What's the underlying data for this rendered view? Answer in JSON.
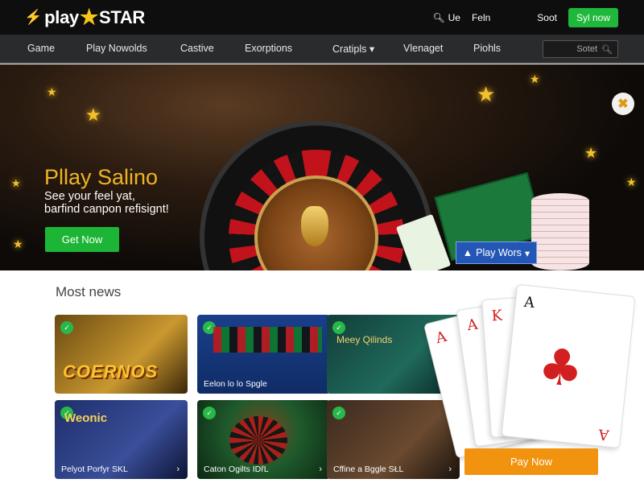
{
  "header": {
    "brand_left": "play",
    "brand_right": "STAR",
    "search_label": "Ue",
    "login_label": "Feln",
    "sort_label": "Soot",
    "signup_label": "Syl now"
  },
  "nav": {
    "items": [
      "Game",
      "Play Nowolds",
      "Castive",
      "Exorptions",
      "Cratipls",
      "Vlenaget",
      "Piohls"
    ],
    "search_placeholder": "Sotet"
  },
  "hero": {
    "title": "Pllay Salino",
    "subtitle": "See your feel yat, barfind canpon refisignt!",
    "cta_label": "Get Now",
    "dropdown_label": "Play Wors",
    "badge": "✖"
  },
  "main": {
    "section_title": "Most news",
    "tiles": [
      {
        "caption": "",
        "big_label": "COERNOS",
        "chev": "",
        "theme": "gold"
      },
      {
        "caption": "Eelon lo lo Spgle",
        "big_label": "",
        "chev": "",
        "theme": "blue"
      },
      {
        "caption": "",
        "big_label": "",
        "small_label": "Meey Qilinds",
        "chev": "",
        "theme": "teal"
      },
      {
        "caption": "Pelyot Porfyr SKL",
        "big_label": "",
        "small_label": "Weonic",
        "chev": "›",
        "theme": "navy"
      },
      {
        "caption": "Caton Ogilts IDřL",
        "big_label": "",
        "chev": "›",
        "theme": "green"
      },
      {
        "caption": "Cffine a Bggle SŁL",
        "big_label": "",
        "chev": "›",
        "theme": "dark"
      }
    ],
    "pay_now_label": "Pay Now",
    "cards": [
      "A",
      "A",
      "K",
      "A",
      "A"
    ]
  },
  "colors": {
    "brand_green": "#1fb83b",
    "hero_gold": "#f0b422",
    "pay_orange": "#f2930f",
    "nav_bg": "#2a2b2d"
  }
}
